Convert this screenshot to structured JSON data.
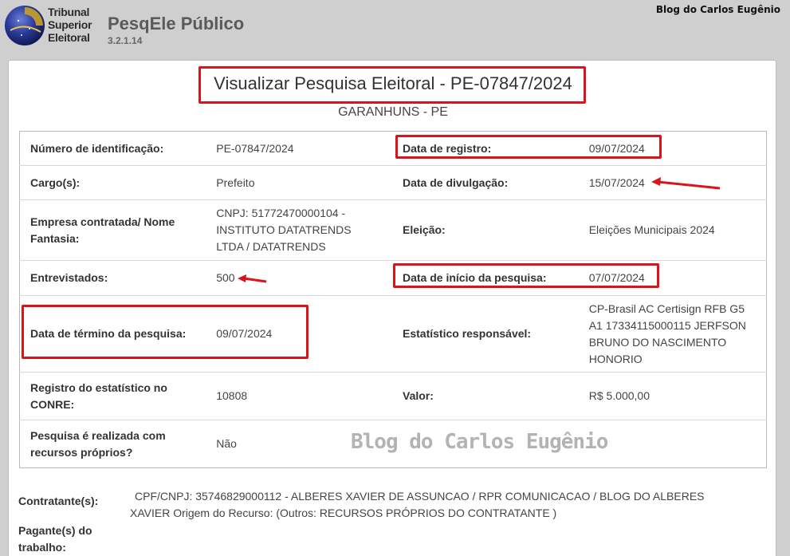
{
  "header": {
    "org_line1": "Tribunal",
    "org_line2": "Superior",
    "org_line3": "Eleitoral",
    "app_title": "PesqEle Público",
    "app_version": "3.2.1.14",
    "blog_label": "Blog do Carlos Eugênio"
  },
  "page": {
    "title": "Visualizar Pesquisa Eleitoral - PE-07847/2024",
    "subtitle": "GARANHUNS - PE"
  },
  "rows": [
    {
      "label_a": "Número de identificação:",
      "value_a": "PE-07847/2024",
      "label_b": "Data de registro:",
      "value_b": "09/07/2024"
    },
    {
      "label_a": "Cargo(s):",
      "value_a": "Prefeito",
      "label_b": "Data de divulgação:",
      "value_b": "15/07/2024"
    },
    {
      "label_a": "Empresa contratada/ Nome Fantasia:",
      "value_a": "CNPJ: 51772470000104 - INSTITUTO DATATRENDS LTDA / DATATRENDS",
      "label_b": "Eleição:",
      "value_b": "Eleições Municipais 2024"
    },
    {
      "label_a": "Entrevistados:",
      "value_a": "500",
      "label_b": "Data de início da pesquisa:",
      "value_b": "07/07/2024"
    },
    {
      "label_a": "Data de término da pesquisa:",
      "value_a": "09/07/2024",
      "label_b": "Estatístico responsável:",
      "value_b": "CP-Brasil AC Certisign RFB G5 A1 17334115000115 JERFSON BRUNO DO NASCIMENTO HONORIO"
    },
    {
      "label_a": "Registro do estatístico no CONRE:",
      "value_a": "10808",
      "label_b": "Valor:",
      "value_b": "R$ 5.000,00"
    },
    {
      "label_a": "Pesquisa é realizada com recursos próprios?",
      "value_a": "Não",
      "label_b": "",
      "value_b": ""
    }
  ],
  "contratante": {
    "label": "Contratante(s):",
    "value_line1": "CPF/CNPJ: 35746829000112 - ALBERES XAVIER DE ASSUNCAO / RPR COMUNICACAO / BLOG DO ALBERES",
    "value_line2": "XAVIER Origem do Recurso: (Outros: RECURSOS PRÓPRIOS DO CONTRATANTE )"
  },
  "pagante": {
    "label": "Pagante(s) do trabalho:"
  },
  "watermark": "Blog do Carlos Eugênio",
  "colors": {
    "annotation_red": "#d9151b",
    "header_bg": "#cfcfcf",
    "panel_bg": "#ffffff"
  }
}
